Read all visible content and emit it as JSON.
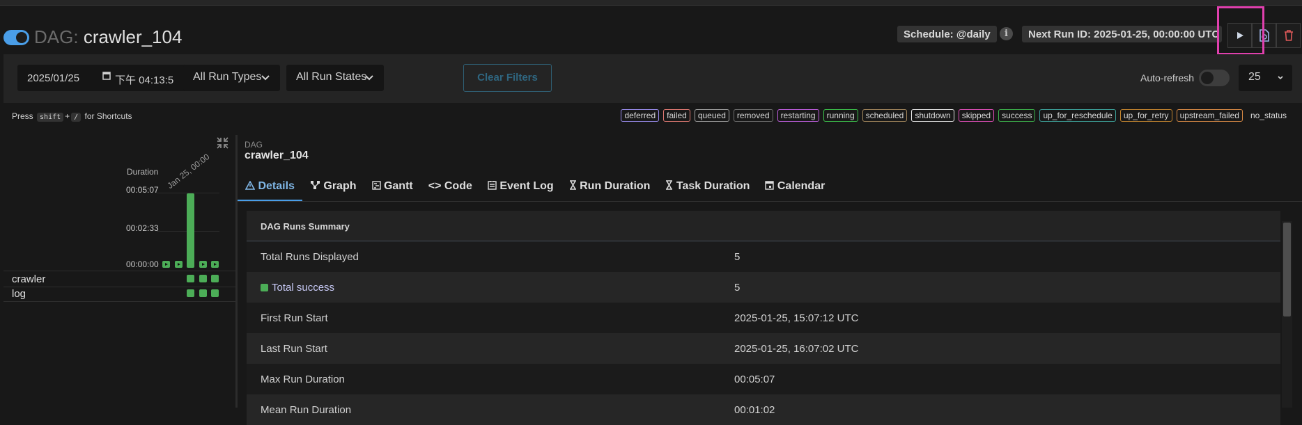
{
  "header": {
    "dag_prefix": "DAG:",
    "dag_id": "crawler_104",
    "schedule": "Schedule: @daily",
    "next_run": "Next Run ID: 2025-01-25, 00:00:00 UTC"
  },
  "filters": {
    "date_value": "2025/01/25",
    "time_value": "下午 04:13:5",
    "run_types": "All Run Types",
    "run_states": "All Run States",
    "clear_label": "Clear Filters",
    "auto_refresh_label": "Auto-refresh",
    "page_size": "25"
  },
  "shortcuts": {
    "press": "Press",
    "key1": "shift",
    "plus": "+",
    "key2": "/",
    "suffix": "for Shortcuts"
  },
  "legend": [
    {
      "label": "deferred",
      "color": "#9b8ef0"
    },
    {
      "label": "failed",
      "color": "#e37b74"
    },
    {
      "label": "queued",
      "color": "#a0a0a0"
    },
    {
      "label": "removed",
      "color": "#6f6f6f"
    },
    {
      "label": "restarting",
      "color": "#c05fe0"
    },
    {
      "label": "running",
      "color": "#3cc24b"
    },
    {
      "label": "scheduled",
      "color": "#a2865c"
    },
    {
      "label": "shutdown",
      "color": "#e7e7e7"
    },
    {
      "label": "skipped",
      "color": "#e04fb8"
    },
    {
      "label": "success",
      "color": "#3cb24b"
    },
    {
      "label": "up_for_reschedule",
      "color": "#3da39b"
    },
    {
      "label": "up_for_retry",
      "color": "#c5862f"
    },
    {
      "label": "upstream_failed",
      "color": "#d98a45"
    },
    {
      "label": "no_status",
      "color": ""
    }
  ],
  "grid": {
    "duration_label": "Duration",
    "date_label": "Jan 25, 00:00",
    "ticks": [
      "00:05:07",
      "00:02:33",
      "00:00:00"
    ],
    "run_durations_s": [
      10,
      5,
      307,
      5,
      5
    ],
    "tasks": [
      "crawler",
      "log"
    ]
  },
  "details": {
    "dag_label": "DAG",
    "dag_name": "crawler_104",
    "tabs": [
      "Details",
      "Graph",
      "Gantt",
      "Code",
      "Event Log",
      "Run Duration",
      "Task Duration",
      "Calendar"
    ],
    "table_title": "DAG Runs Summary",
    "rows": [
      {
        "key": "Total Runs Displayed",
        "value": "5"
      },
      {
        "key": "Total success",
        "value": "5"
      },
      {
        "key": "First Run Start",
        "value": "2025-01-25, 15:07:12 UTC"
      },
      {
        "key": "Last Run Start",
        "value": "2025-01-25, 16:07:02 UTC"
      },
      {
        "key": "Max Run Duration",
        "value": "00:05:07"
      },
      {
        "key": "Mean Run Duration",
        "value": "00:01:02"
      }
    ]
  }
}
